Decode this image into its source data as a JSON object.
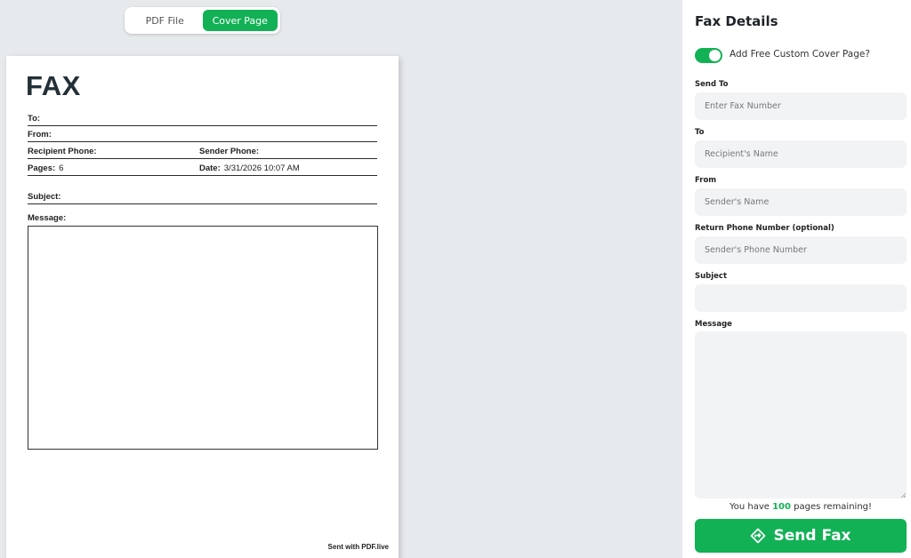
{
  "tabs": [
    {
      "label": "PDF File",
      "active": false
    },
    {
      "label": "Cover Page",
      "active": true
    }
  ],
  "fax_page": {
    "title": "FAX",
    "to_label": "To:",
    "from_label": "From:",
    "recipient_phone_label": "Recipient Phone:",
    "sender_phone_label": "Sender Phone:",
    "pages_label": "Pages:",
    "pages_value": "6",
    "date_label": "Date:",
    "date_value": "3/31/2026 10:07 AM",
    "subject_label": "Subject:",
    "message_label": "Message:",
    "footer": "Sent with PDF.live"
  },
  "panel": {
    "title": "Fax Details",
    "toggle_label": "Add Free Custom Cover Page?",
    "toggle_on": true,
    "fields": {
      "send_to": {
        "label": "Send To",
        "placeholder": "Enter Fax Number",
        "value": ""
      },
      "to": {
        "label": "To",
        "placeholder": "Recipient's Name",
        "value": ""
      },
      "from": {
        "label": "From",
        "placeholder": "Sender's Name",
        "value": ""
      },
      "return_phone": {
        "label": "Return Phone Number (optional)",
        "placeholder": "Sender's Phone Number",
        "value": ""
      },
      "subject": {
        "label": "Subject",
        "placeholder": "",
        "value": ""
      },
      "message": {
        "label": "Message",
        "placeholder": "",
        "value": ""
      }
    },
    "pages_note_prefix": "You have",
    "pages_remaining": "100",
    "pages_note_suffix": "pages remaining!",
    "send_button_label": "Send Fax",
    "send_icon": "diamond-arrow-icon"
  },
  "colors": {
    "accent": "#12b155",
    "background": "#e7eaed",
    "input_bg": "#f2f3f5"
  }
}
